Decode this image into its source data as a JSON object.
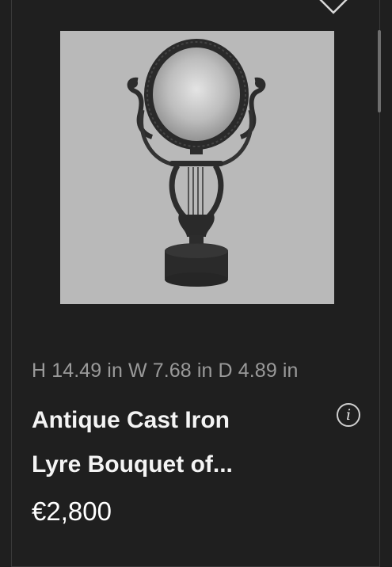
{
  "product": {
    "dimensions": "H 14.49 in W 7.68 in D 4.89 in",
    "title_line1": "Antique Cast Iron",
    "title_line2": "Lyre Bouquet of...",
    "price": "€2,800",
    "image_alt": "Antique cast iron lyre shaped table mirror"
  },
  "icons": {
    "chevron": "chevron-down-icon",
    "info": "info-icon",
    "info_glyph": "i"
  },
  "colors": {
    "background": "#1f1f1f",
    "image_background": "#b9b9b9",
    "secondary_text": "#9a9a9a",
    "primary_text": "#f4f4f4"
  }
}
